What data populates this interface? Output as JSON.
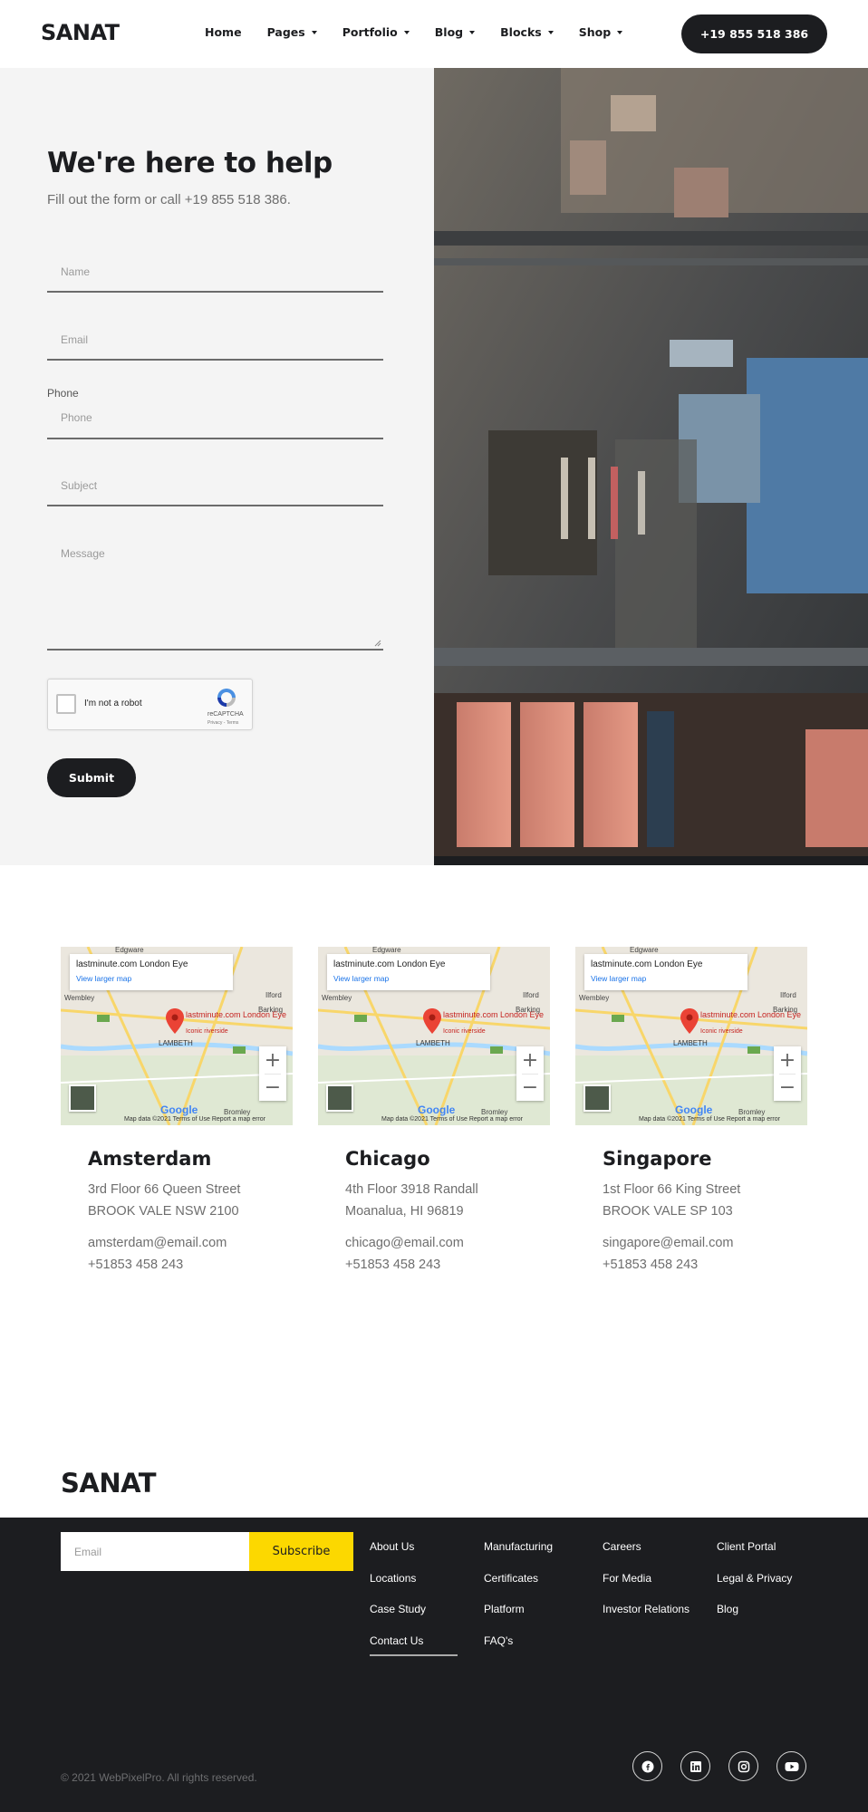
{
  "header": {
    "logo": "SANAT",
    "nav": [
      "Home",
      "Pages",
      "Portfolio",
      "Blog",
      "Blocks",
      "Shop"
    ],
    "nav_has_dropdown": [
      false,
      true,
      true,
      true,
      true,
      true
    ],
    "phone_button": "+19 855 518 386"
  },
  "contact": {
    "title": "We're here to help",
    "subtitle": "Fill out the form or call +19 855 518 386.",
    "fields": {
      "name_placeholder": "Name",
      "email_placeholder": "Email",
      "phone_label": "Phone",
      "phone_placeholder": "Phone",
      "subject_placeholder": "Subject",
      "message_placeholder": "Message"
    },
    "captcha": {
      "label": "I'm not a robot",
      "brand": "reCAPTCHA",
      "terms": "Privacy - Terms"
    },
    "submit": "Submit"
  },
  "map": {
    "place_title": "lastminute.com London Eye",
    "larger_map": "View larger map",
    "pin_label": "lastminute.com London Eye",
    "pin_sub": "Iconic riverside",
    "area_labels": [
      "Edgware",
      "Wembley",
      "Ilford",
      "Barking",
      "LAMBETH",
      "Bromley"
    ],
    "footer": "Map data ©2021   Terms of Use   Report a map error",
    "google": "Google"
  },
  "offices": [
    {
      "city": "Amsterdam",
      "line1": "3rd Floor 66 Queen Street",
      "line2": "BROOK VALE NSW 2100",
      "email": "amsterdam@email.com",
      "phone": "+51853 458 243"
    },
    {
      "city": "Chicago",
      "line1": "4th Floor 3918 Randall",
      "line2": "Moanalua, HI 96819",
      "email": "chicago@email.com",
      "phone": "+51853 458 243"
    },
    {
      "city": "Singapore",
      "line1": "1st Floor 66 King Street",
      "line2": "BROOK VALE SP 103",
      "email": "singapore@email.com",
      "phone": "+51853 458 243"
    }
  ],
  "footer": {
    "logo": "SANAT",
    "email_placeholder": "Email",
    "subscribe": "Subscribe",
    "columns": [
      [
        "About Us",
        "Locations",
        "Case Study",
        "Contact Us"
      ],
      [
        "Manufacturing",
        "Certificates",
        "Platform",
        "FAQ's"
      ],
      [
        "Careers",
        "For Media",
        "Investor Relations"
      ],
      [
        "Client Portal",
        "Legal & Privacy",
        "Blog"
      ]
    ],
    "copyright": "© 2021 WebPixelPro. All rights reserved.",
    "social_icons": [
      "facebook-icon",
      "linkedin-icon",
      "instagram-icon",
      "youtube-icon"
    ]
  }
}
